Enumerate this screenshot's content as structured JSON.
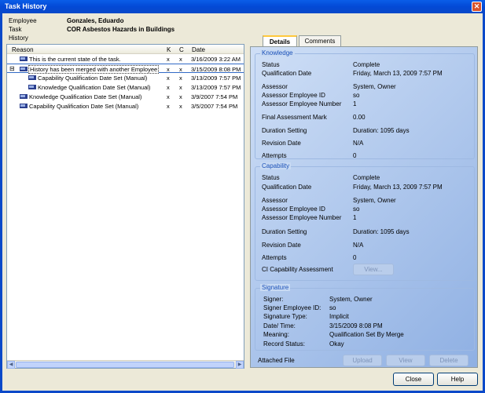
{
  "window": {
    "title": "Task History"
  },
  "header": {
    "employee_label": "Employee",
    "employee_value": "Gonzales, Eduardo",
    "task_label": "Task",
    "task_value": "COR  Asbestos Hazards in Buildings",
    "history_label": "History"
  },
  "tree": {
    "col_reason": "Reason",
    "col_k": "K",
    "col_c": "C",
    "col_date": "Date",
    "rows": [
      {
        "reason": "This is the current state of the task.",
        "k": "x",
        "c": "x",
        "date": "3/16/2009 3:22 AM"
      },
      {
        "reason": "History has been merged with another Employee",
        "k": "x",
        "c": "x",
        "date": "3/15/2009 8:08 PM"
      },
      {
        "reason": "Capability Qualification Date Set (Manual)",
        "k": "x",
        "c": "x",
        "date": "3/13/2009 7:57 PM"
      },
      {
        "reason": "Knowledge Qualification Date Set (Manual)",
        "k": "x",
        "c": "x",
        "date": "3/13/2009 7:57 PM"
      },
      {
        "reason": "Knowledge Qualification Date Set (Manual)",
        "k": "x",
        "c": "x",
        "date": "3/9/2007 7:54 PM"
      },
      {
        "reason": "Capability Qualification Date Set (Manual)",
        "k": "x",
        "c": "x",
        "date": "3/5/2007 7:54 PM"
      }
    ]
  },
  "tabs": {
    "details": "Details",
    "comments": "Comments"
  },
  "knowledge": {
    "title": "Knowledge",
    "status_label": "Status",
    "status_value": "Complete",
    "qdate_label": "Qualification Date",
    "qdate_value": "Friday, March 13, 2009 7:57 PM",
    "assessor_label": "Assessor",
    "assessor_value": "System, Owner",
    "assessor_id_label": "Assessor Employee ID",
    "assessor_id_value": "so",
    "assessor_num_label": "Assessor Employee Number",
    "assessor_num_value": "1",
    "final_mark_label": "Final Assessment Mark",
    "final_mark_value": "0.00",
    "duration_label": "Duration Setting",
    "duration_value": "Duration: 1095 days",
    "revision_label": "Revision Date",
    "revision_value": "N/A",
    "attempts_label": "Attempts",
    "attempts_value": "0"
  },
  "capability": {
    "title": "Capability",
    "status_label": "Status",
    "status_value": "Complete",
    "qdate_label": "Qualification Date",
    "qdate_value": "Friday, March 13, 2009 7:57 PM",
    "assessor_label": "Assessor",
    "assessor_value": "System, Owner",
    "assessor_id_label": "Assessor Employee ID",
    "assessor_id_value": "so",
    "assessor_num_label": "Assessor Employee Number",
    "assessor_num_value": "1",
    "duration_label": "Duration Setting",
    "duration_value": "Duration: 1095 days",
    "revision_label": "Revision Date",
    "revision_value": "N/A",
    "attempts_label": "Attempts",
    "attempts_value": "0",
    "ci_label": "CI Capability Assessment",
    "view_button": "View..."
  },
  "signature": {
    "title": "Signature",
    "signer_label": "Signer:",
    "signer_value": "System, Owner",
    "signer_id_label": "Signer Employee ID:",
    "signer_id_value": "so",
    "type_label": "Signature Type:",
    "type_value": "Implicit",
    "datetime_label": "Date/ Time:",
    "datetime_value": "3/15/2009 8:08 PM",
    "meaning_label": "Meaning:",
    "meaning_value": "Qualification Set By Merge",
    "record_label": "Record Status:",
    "record_value": "Okay"
  },
  "attached": {
    "label": "Attached File",
    "upload": "Upload",
    "view": "View",
    "delete": "Delete"
  },
  "footer": {
    "close": "Close",
    "help": "Help"
  },
  "icons": {
    "close": "close-icon",
    "folder": "history-icon",
    "collapse": "collapse-icon"
  },
  "colors": {
    "titlebar": "#0A5EE8",
    "panel": "#A9C4EC",
    "group_title": "#1A50B8"
  }
}
